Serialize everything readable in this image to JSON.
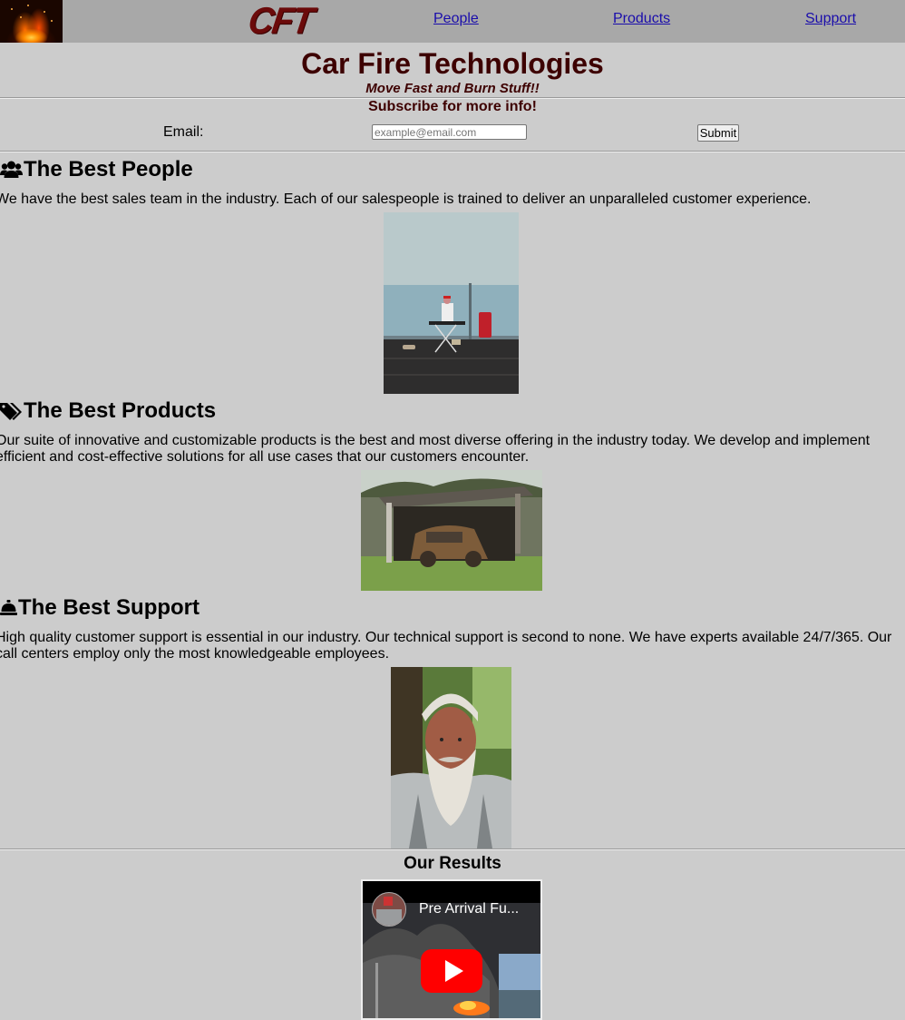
{
  "nav": {
    "logo_text": "CFT",
    "links": [
      "People",
      "Products",
      "Support"
    ]
  },
  "header": {
    "title": "Car Fire Technologies",
    "tagline": "Move Fast and Burn Stuff!!"
  },
  "subscribe": {
    "heading": "Subscribe for more info!",
    "email_label": "Email:",
    "email_placeholder": "example@email.com",
    "submit_label": "Submit"
  },
  "sections": [
    {
      "title": "The Best People",
      "icon": "users-icon",
      "body": "We have the best sales team in the industry. Each of our salespeople is trained to deliver an unparalleled customer experience."
    },
    {
      "title": "The Best Products",
      "icon": "tags-icon",
      "body": "Our suite of innovative and customizable products is the best and most diverse offering in the industry today. We develop and implement efficient and cost-effective solutions for all use cases that our customers encounter."
    },
    {
      "title": "The Best Support",
      "icon": "concierge-bell-icon",
      "body": "High quality customer support is essential in our industry. Our technical support is second to none. We have experts available 24/7/365. Our call centers employ only the most knowledgeable employees."
    }
  ],
  "results": {
    "heading": "Our Results",
    "video_title": "Pre Arrival Fu..."
  },
  "colors": {
    "brand_dark_red": "#3d0000",
    "navbar_bg": "#a8a8a8",
    "page_bg": "#cccccc",
    "link_blue": "#1a0dab"
  }
}
